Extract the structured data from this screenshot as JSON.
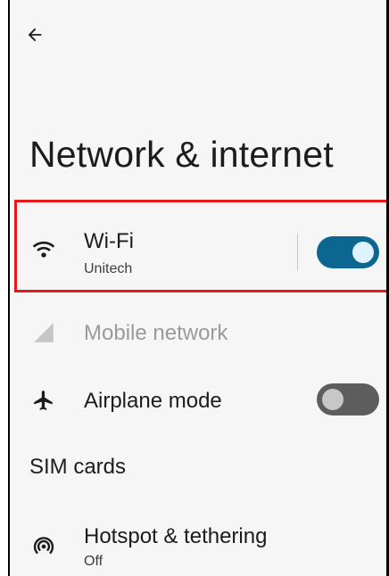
{
  "page": {
    "title": "Network & internet"
  },
  "icons": {
    "back": "arrow-back-icon",
    "wifi": "wifi-icon",
    "mobile": "signal-icon",
    "airplane": "airplane-icon",
    "hotspot": "hotspot-icon"
  },
  "items": {
    "wifi": {
      "title": "Wi-Fi",
      "subtitle": "Unitech",
      "toggle": "on"
    },
    "mobile": {
      "title": "Mobile network",
      "state": "disabled"
    },
    "airplane": {
      "title": "Airplane mode",
      "toggle": "off"
    },
    "sim": {
      "title": "SIM cards"
    },
    "hotspot": {
      "title": "Hotspot & tethering",
      "subtitle": "Off"
    }
  },
  "colors": {
    "background": "#f6f6f6",
    "toggle_on": "#0d6690",
    "toggle_off": "#5d5d5d",
    "highlight": "#e8171a",
    "disabled_text": "#9a9a9a"
  }
}
